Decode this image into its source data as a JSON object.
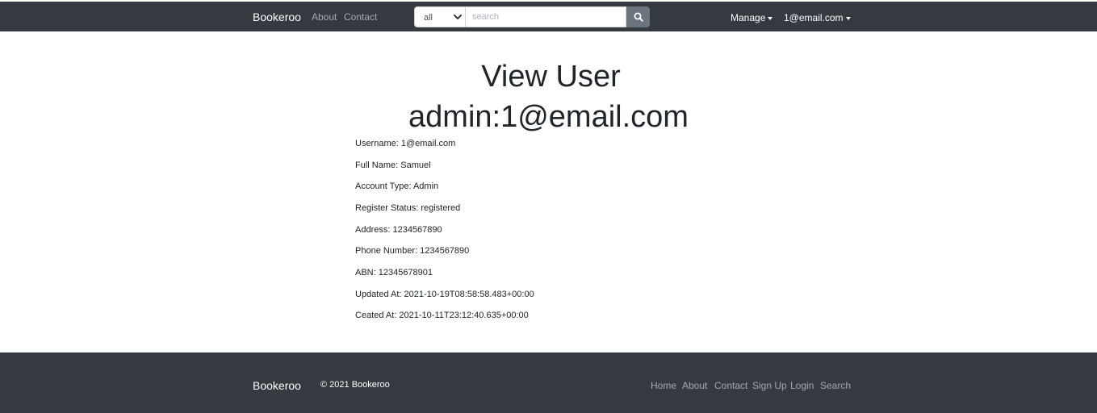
{
  "navbar": {
    "brand": "Bookeroo",
    "links": {
      "about": "About",
      "contact": "Contact"
    },
    "search": {
      "category": "all",
      "placeholder": "search",
      "value": ""
    },
    "manage_label": "Manage",
    "user_label": "1@email.com"
  },
  "main": {
    "title": "View User",
    "subtitle": "admin:1@email.com",
    "details": {
      "username": "Username: 1@email.com",
      "full_name": "Full Name: Samuel",
      "account_type": "Account Type: Admin",
      "register_status": "Register Status: registered",
      "address": "Address: 1234567890",
      "phone": "Phone Number: 1234567890",
      "abn": "ABN: 12345678901",
      "updated_at": "Updated At: 2021-10-19T08:58:58.483+00:00",
      "created_at": "Ceated At: 2021-10-11T23:12:40.635+00:00"
    }
  },
  "footer": {
    "brand": "Bookeroo",
    "copyright": "© 2021 Bookeroo",
    "links": {
      "home": "Home",
      "about": "About",
      "contact": "Contact",
      "signup": "Sign Up",
      "login": "Login",
      "search": "Search"
    }
  },
  "colors": {
    "navbar_bg": "#343a40",
    "search_button_bg": "#6c757d"
  }
}
